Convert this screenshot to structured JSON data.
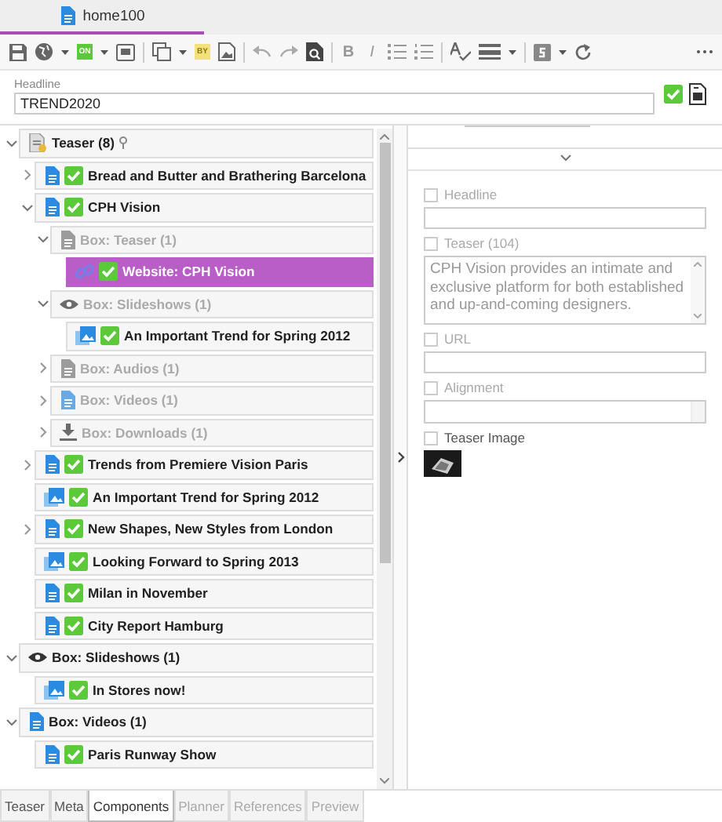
{
  "document_tab": {
    "title": "home100",
    "selected": true
  },
  "toolbar": {
    "online_badge": "ON",
    "by_badge": "BY",
    "bold_button": "B",
    "italic_button": "I"
  },
  "headline": {
    "label": "Headline",
    "value": "TREND2020"
  },
  "tree": [
    {
      "label": "Teaser (8)",
      "kind": "list",
      "expanded": true,
      "pinned": true,
      "dimmed": false,
      "selected": false,
      "children": [
        {
          "label": "Bread and Butter and Brathering Barcelona",
          "kind": "article",
          "approved": true,
          "expanded": false,
          "dimmed": false,
          "selected": false
        },
        {
          "label": "CPH Vision",
          "kind": "article",
          "approved": true,
          "expanded": true,
          "dimmed": false,
          "selected": false,
          "children": [
            {
              "label": "Box: Teaser (1)",
              "kind": "box",
              "expanded": true,
              "dimmed": true,
              "selected": false,
              "children": [
                {
                  "label": "Website: CPH Vision",
                  "kind": "link",
                  "approved": true,
                  "dimmed": false,
                  "selected": true
                }
              ]
            },
            {
              "label": "Box: Slideshows (1)",
              "kind": "slides",
              "expanded": true,
              "dimmed": true,
              "selected": false,
              "children": [
                {
                  "label": "An Important Trend for Spring 2012",
                  "kind": "picture",
                  "approved": true,
                  "dimmed": false,
                  "selected": false
                }
              ]
            },
            {
              "label": "Box: Audios (1)",
              "kind": "box",
              "expanded": false,
              "dimmed": true,
              "selected": false
            },
            {
              "label": "Box: Videos (1)",
              "kind": "video",
              "expanded": false,
              "dimmed": true,
              "selected": false
            },
            {
              "label": "Box: Downloads (1)",
              "kind": "download",
              "expanded": false,
              "dimmed": true,
              "selected": false
            }
          ]
        },
        {
          "label": "Trends from Premiere Vision Paris",
          "kind": "article",
          "approved": true,
          "expanded": false,
          "dimmed": false,
          "selected": false
        },
        {
          "label": "An Important Trend for Spring 2012",
          "kind": "picture",
          "approved": true,
          "dimmed": false,
          "selected": false
        },
        {
          "label": "New Shapes, New Styles from London",
          "kind": "article",
          "approved": true,
          "expanded": false,
          "dimmed": false,
          "selected": false
        },
        {
          "label": "Looking Forward to Spring 2013",
          "kind": "picture",
          "approved": true,
          "dimmed": false,
          "selected": false
        },
        {
          "label": "Milan in November",
          "kind": "article",
          "approved": true,
          "dimmed": false,
          "selected": false
        },
        {
          "label": "City Report Hamburg",
          "kind": "article",
          "approved": true,
          "dimmed": false,
          "selected": false
        }
      ]
    },
    {
      "label": "Box: Slideshows (1)",
      "kind": "slides",
      "expanded": true,
      "dimmed": false,
      "selected": false,
      "children": [
        {
          "label": "In Stores now!",
          "kind": "picture",
          "approved": true,
          "dimmed": false,
          "selected": false
        }
      ]
    },
    {
      "label": "Box: Videos (1)",
      "kind": "video",
      "expanded": true,
      "dimmed": false,
      "selected": false,
      "children": [
        {
          "label": "Paris Runway Show",
          "kind": "article",
          "approved": true,
          "dimmed": false,
          "selected": false
        }
      ]
    }
  ],
  "detail": {
    "fields": [
      {
        "kind": "input",
        "label": "Headline",
        "checked": false,
        "disabled": true
      },
      {
        "kind": "textarea",
        "label": "Teaser (104)",
        "checked": false,
        "disabled": true,
        "value": "CPH Vision provides an intimate and exclusive platform for both established and up-and-coming designers."
      },
      {
        "kind": "input",
        "label": "URL",
        "checked": false,
        "disabled": true
      },
      {
        "kind": "select",
        "label": "Alignment",
        "checked": false,
        "disabled": true
      },
      {
        "kind": "image",
        "label": "Teaser Image",
        "checked": false,
        "disabled": false
      }
    ]
  },
  "bottom_tabs": [
    {
      "label": "Teaser",
      "selected": false,
      "disabled": false
    },
    {
      "label": "Meta",
      "selected": false,
      "disabled": false
    },
    {
      "label": "Components",
      "selected": true,
      "disabled": false
    },
    {
      "label": "Planner",
      "selected": false,
      "disabled": true
    },
    {
      "label": "References",
      "selected": false,
      "disabled": true
    },
    {
      "label": "Preview",
      "selected": false,
      "disabled": true
    }
  ]
}
